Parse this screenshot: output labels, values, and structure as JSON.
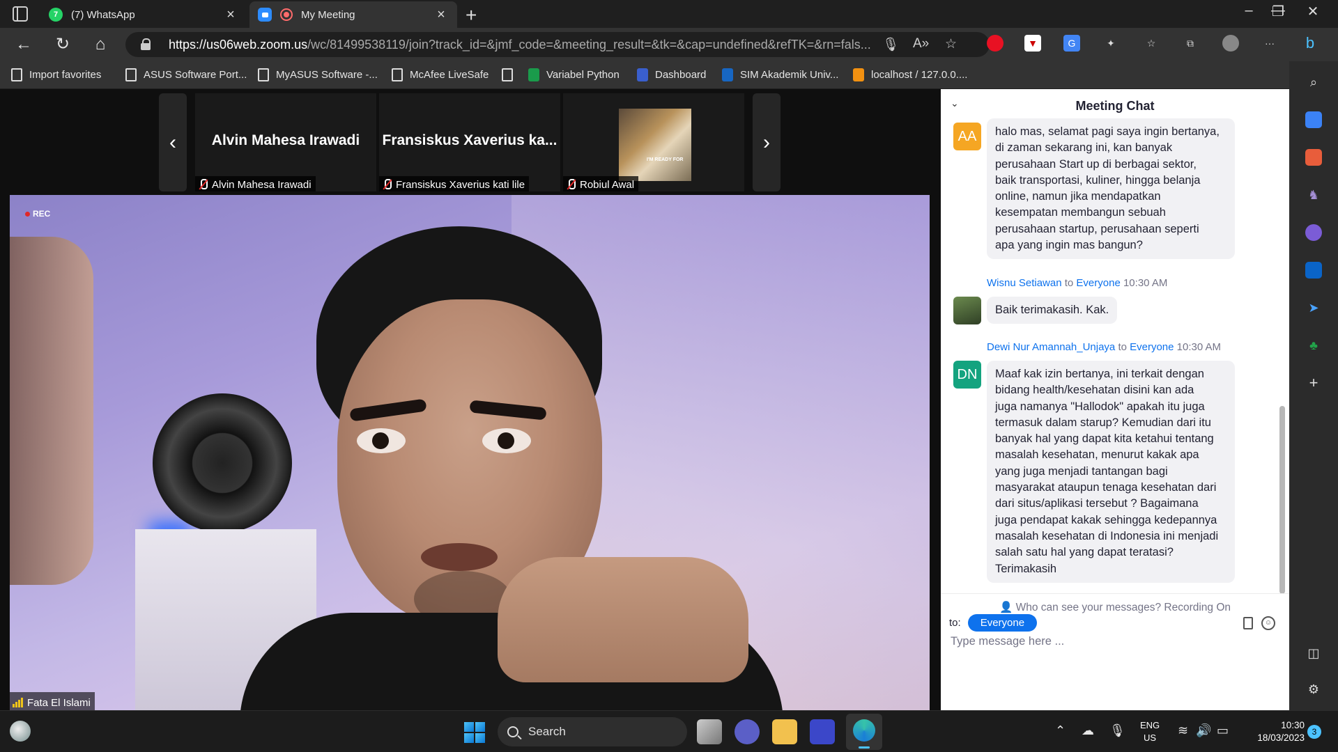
{
  "browser": {
    "tabs": [
      {
        "label": "(7) WhatsApp",
        "favicon": "whatsapp-icon",
        "badge": "7"
      },
      {
        "label": "My Meeting",
        "favicon": "zoom-icon",
        "recording": true
      }
    ],
    "url_host": "https://us06web.zoom.us",
    "url_path": "/wc/81499538119/join?track_id=&jmf_code=&meeting_result=&tk=&cap=undefined&refTK=&rn=fals...",
    "favorites": [
      {
        "label": "Import favorites",
        "icon": "import-icon"
      },
      {
        "label": "ASUS Software Port...",
        "icon": "page-icon"
      },
      {
        "label": "MyASUS Software -...",
        "icon": "page-icon"
      },
      {
        "label": "McAfee LiveSafe",
        "icon": "page-icon"
      },
      {
        "label": "",
        "icon": "page-icon"
      },
      {
        "label": "Variabel Python",
        "icon": "w-icon"
      },
      {
        "label": "Dashboard",
        "icon": "dashboard-icon"
      },
      {
        "label": "SIM Akademik Univ...",
        "icon": "university-icon"
      },
      {
        "label": "localhost / 127.0.0....",
        "icon": "phpmyadmin-icon"
      }
    ]
  },
  "meeting": {
    "participants": [
      {
        "display": "Alvin Mahesa Irawadi",
        "footer": "Alvin Mahesa Irawadi",
        "muted": true
      },
      {
        "display": "Fransiskus Xaverius ka...",
        "footer": "Fransiskus Xaverius kati lile",
        "muted": true
      },
      {
        "display": "",
        "footer": "Robiul Awal",
        "muted": true,
        "photo_caption": "I'M READY FOR"
      }
    ],
    "rec_label": "REC",
    "active_speaker": "Fata El Islami"
  },
  "chat": {
    "title": "Meeting Chat",
    "messages": [
      {
        "avatar": "AA",
        "avatar_color": "#f5a623",
        "sender": "",
        "to": "",
        "recipient": "",
        "time": "",
        "lines": [
          "halo mas, selamat pagi saya ingin bertanya,",
          "di zaman sekarang ini, kan banyak",
          "perusahaan Start up di berbagai sektor,",
          "baik transportasi, kuliner, hingga belanja",
          "online, namun jika mendapatkan",
          "kesempatan membangun sebuah",
          "perusahaan startup, perusahaan seperti",
          "apa yang ingin mas bangun?"
        ]
      },
      {
        "avatar": "",
        "avatar_color": "#4f6b3a",
        "sender": "Wisnu Setiawan",
        "to": "to",
        "recipient": "Everyone",
        "time": "10:30 AM",
        "lines": [
          "Baik terimakasih. Kak."
        ]
      },
      {
        "avatar": "DN",
        "avatar_color": "#14a37f",
        "sender": "Dewi Nur Amannah_Unjaya",
        "to": "to",
        "recipient": "Everyone",
        "time": "10:30 AM",
        "lines": [
          "Maaf kak izin bertanya, ini terkait dengan",
          "bidang health/kesehatan disini kan ada",
          "juga namanya \"Hallodok\" apakah itu juga",
          "termasuk dalam starup? Kemudian dari itu",
          "banyak hal yang dapat kita ketahui tentang",
          "masalah kesehatan, menurut kakak apa",
          "yang juga menjadi tantangan bagi",
          "masyarakat ataupun tenaga kesehatan dari",
          "dari situs/aplikasi tersebut ? Bagaimana",
          "juga pendapat kakak sehingga kedepannya",
          "masalah kesehatan di Indonesia ini menjadi",
          "salah satu hal yang dapat teratasi?",
          "Terimakasih"
        ]
      }
    ],
    "visibility_note": "Who can see your messages? Recording On",
    "to_label": "to:",
    "to_value": "Everyone",
    "input_placeholder": "Type message here ..."
  },
  "taskbar": {
    "search_label": "Search",
    "lang_line1": "ENG",
    "lang_line2": "US",
    "time": "10:30",
    "date": "18/03/2023",
    "notification_count": "3"
  }
}
